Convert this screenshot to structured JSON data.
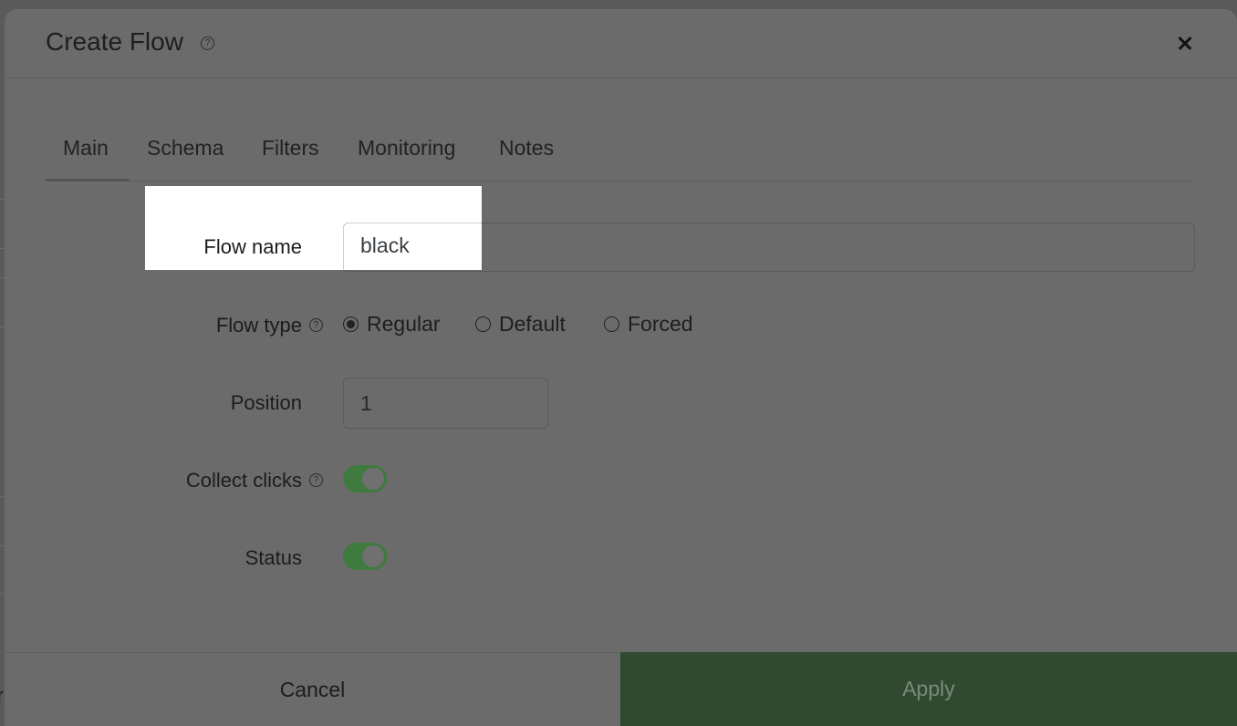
{
  "dialog": {
    "title": "Create Flow",
    "close_label": "×"
  },
  "tabs": [
    {
      "label": "Main",
      "active": true
    },
    {
      "label": "Schema",
      "active": false
    },
    {
      "label": "Filters",
      "active": false
    },
    {
      "label": "Monitoring",
      "active": false
    },
    {
      "label": "Notes",
      "active": false
    }
  ],
  "form": {
    "flow_name": {
      "label": "Flow name",
      "value": "black"
    },
    "flow_type": {
      "label": "Flow type",
      "options": [
        "Regular",
        "Default",
        "Forced"
      ],
      "selected": "Regular"
    },
    "position": {
      "label": "Position",
      "value": "1"
    },
    "collect_clicks": {
      "label": "Collect clicks",
      "enabled": true
    },
    "status": {
      "label": "Status",
      "enabled": true
    }
  },
  "footer": {
    "cancel_label": "Cancel",
    "apply_label": "Apply"
  },
  "background": {
    "edge_text": "r"
  },
  "colors": {
    "toggle_on": "#3f7a3f",
    "apply_bg": "#2f4a2e",
    "highlight": "#ffffff"
  }
}
